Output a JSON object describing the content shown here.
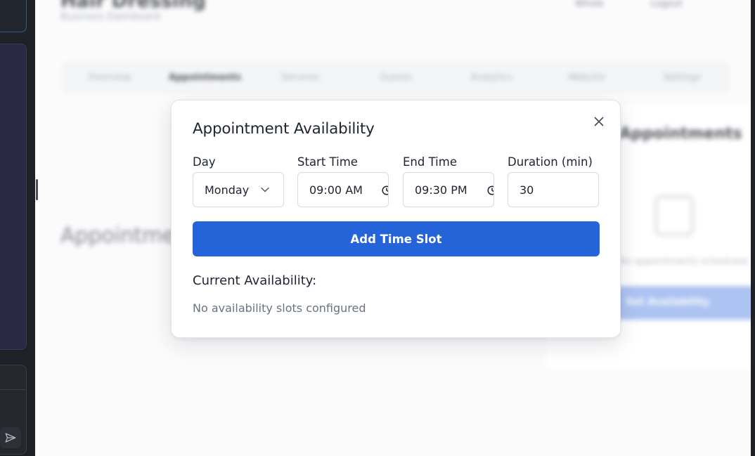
{
  "background_app": {
    "title": "Hair Dressing",
    "subtitle": "Business Dashboard",
    "header_items": [
      "Whole",
      "Logout"
    ],
    "tabs": [
      "Overview",
      "Appointments",
      "Services",
      "Guests",
      "Analytics",
      "Website",
      "Settings"
    ],
    "active_tab": "Appointments",
    "section_heading": "Appointments",
    "upcoming": {
      "title": "Appointments",
      "empty_text": "No appointments scheduled",
      "button_label": "Set Availability"
    }
  },
  "modal": {
    "title": "Appointment Availability",
    "fields": {
      "day": {
        "label": "Day",
        "value": "Monday"
      },
      "start_time": {
        "label": "Start Time",
        "value": "09:00 AM"
      },
      "end_time": {
        "label": "End Time",
        "value": "09:30 PM"
      },
      "duration": {
        "label": "Duration (min)",
        "value": "30"
      }
    },
    "add_button_label": "Add Time Slot",
    "current_label": "Current Availability:",
    "empty_text": "No availability slots configured"
  },
  "colors": {
    "primary": "#2563d9",
    "sidebar_dark": "#1f2127",
    "sidebar_panel": "#2a2842"
  },
  "icons": [
    "close-icon",
    "chevron-down-icon",
    "clock-icon",
    "send-icon",
    "calendar-icon"
  ]
}
